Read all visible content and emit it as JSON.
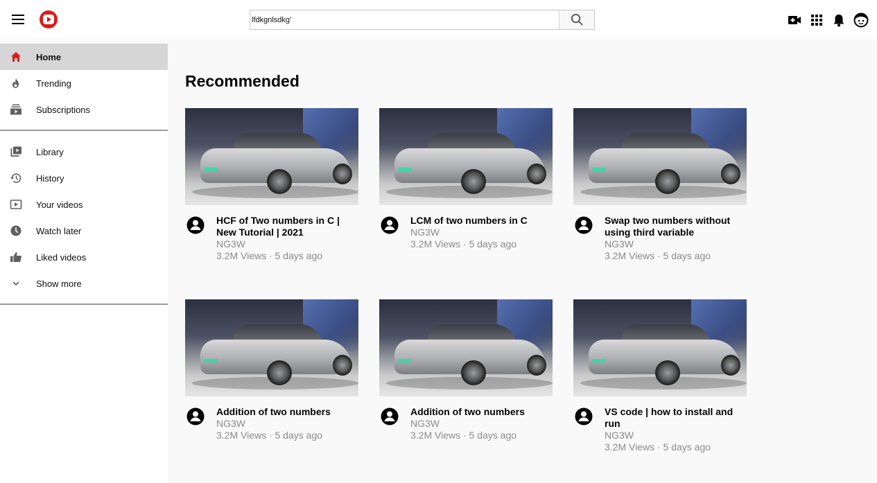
{
  "header": {
    "search_value": "lfdkgnlsdkg'",
    "icons": [
      "menu-icon",
      "youtube-logo-icon",
      "search-icon",
      "create-video-icon",
      "apps-grid-icon",
      "notifications-bell-icon",
      "account-avatar-icon"
    ]
  },
  "sidebar": {
    "primary": [
      {
        "label": "Home",
        "icon": "home-icon",
        "active": true
      },
      {
        "label": "Trending",
        "icon": "flame-icon"
      },
      {
        "label": "Subscriptions",
        "icon": "subscriptions-icon"
      }
    ],
    "secondary": [
      {
        "label": "Library",
        "icon": "library-icon"
      },
      {
        "label": "History",
        "icon": "history-icon"
      },
      {
        "label": "Your videos",
        "icon": "your-videos-icon"
      },
      {
        "label": "Watch later",
        "icon": "clock-icon"
      },
      {
        "label": "Liked videos",
        "icon": "thumbs-up-icon"
      },
      {
        "label": "Show more",
        "icon": "chevron-down-icon"
      }
    ]
  },
  "main": {
    "section_title": "Recommended",
    "videos": [
      {
        "title": "HCF of Two numbers in C | New Tutorial | 2021",
        "channel": "NG3W",
        "stats": "3.2M Views · 5 days ago"
      },
      {
        "title": "LCM of two numbers in C",
        "channel": "NG3W",
        "stats": "3.2M Views · 5 days ago"
      },
      {
        "title": "Swap two numbers without using third variable",
        "channel": "NG3W",
        "stats": "3.2M Views · 5 days ago"
      },
      {
        "title": "Addition of two numbers",
        "channel": "NG3W",
        "stats": "3.2M Views · 5 days ago"
      },
      {
        "title": "Addition of two numbers",
        "channel": "NG3W",
        "stats": "3.2M Views · 5 days ago"
      },
      {
        "title": "VS code | how to install and run",
        "channel": "NG3W",
        "stats": "3.2M Views · 5 days ago"
      }
    ]
  },
  "colors": {
    "brand_red": "#e01a1a",
    "active_item_bg": "#d6d6d6",
    "meta_gray": "#8a8a8a"
  }
}
